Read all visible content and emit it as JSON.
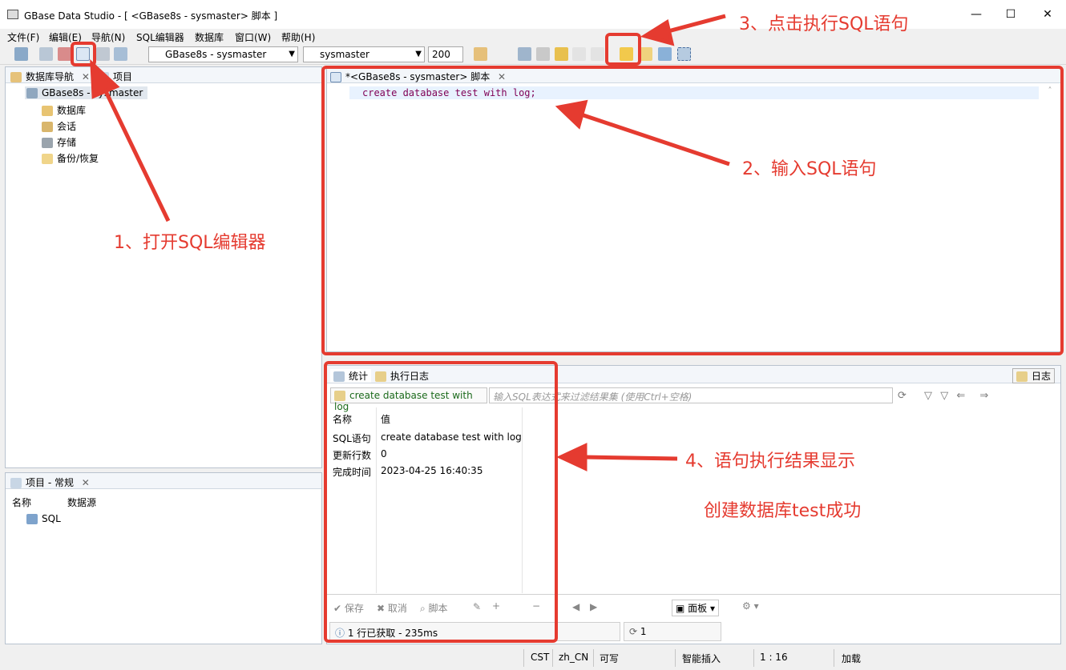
{
  "window": {
    "title": "GBase Data Studio - [ <GBase8s - sysmaster> 脚本 ]",
    "min": "—",
    "max": "☐",
    "close": "✕"
  },
  "menu": [
    "文件(F)",
    "编辑(E)",
    "导航(N)",
    "SQL编辑器",
    "数据库",
    "窗口(W)",
    "帮助(H)"
  ],
  "toolbar": {
    "connection": "GBase8s - sysmaster",
    "database": "sysmaster",
    "limit": "200"
  },
  "navigator": {
    "tab_label": "数据库导航",
    "tab2_label": "项目",
    "root": "GBase8s - sysmaster",
    "children": [
      "数据库",
      "会话",
      "存储",
      "备份/恢复"
    ]
  },
  "project": {
    "tab_label": "项目 - 常规",
    "col_name": "名称",
    "col_source": "数据源",
    "item": "SQL"
  },
  "editor": {
    "tab_label": "*<GBase8s - sysmaster> 脚本",
    "code": "create database test with log;"
  },
  "results": {
    "tab_stats": "统计",
    "tab_log": "执行日志",
    "log_button": "日志",
    "query_label": "create database test with log",
    "filter_placeholder": "输入SQL表达式来过滤结果集 (使用Ctrl+空格)",
    "header_name": "名称",
    "header_value": "值",
    "rows": [
      {
        "name": "SQL语句",
        "value": "create database test with log"
      },
      {
        "name": "更新行数",
        "value": "0"
      },
      {
        "name": "完成时间",
        "value": "2023-04-25 16:40:35"
      }
    ],
    "btn_save": "保存",
    "btn_cancel": "取消",
    "btn_script": "脚本",
    "btn_panel": "面板",
    "status": "1 行已获取 - 235ms",
    "refresh_count": "1"
  },
  "statusbar": {
    "tz": "CST",
    "locale": "zh_CN",
    "writable": "可写",
    "insert": "智能插入",
    "pos": "1 : 16",
    "loaded": "加载"
  },
  "annotations": {
    "a1": "1、打开SQL编辑器",
    "a2": "2、输入SQL语句",
    "a3": "3、点击执行SQL语句",
    "a4": "4、语句执行结果显示",
    "a5": "创建数据库test成功"
  },
  "colors": {
    "accent_red": "#e53b30"
  }
}
